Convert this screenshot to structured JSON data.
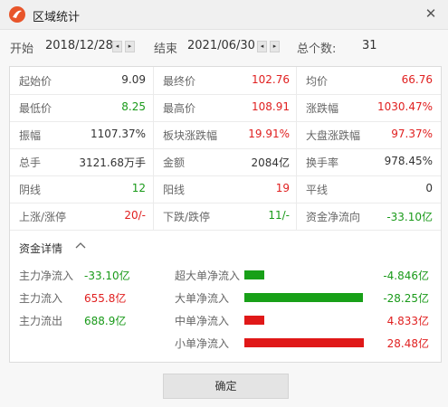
{
  "window": {
    "title": "区域统计",
    "close_glyph": "✕",
    "icons": [
      "app-logo-icon",
      "close-icon"
    ]
  },
  "range": {
    "start_label": "开始",
    "start_value": "2018/12/28",
    "end_label": "结束",
    "end_value": "2021/06/30",
    "count_label": "总个数:",
    "count_value": "31",
    "left_arrow": "◂",
    "right_arrow": "▸"
  },
  "colors": {
    "red": "#e02020",
    "green": "#1a9a1a",
    "bar_green": "#18a018",
    "bar_red": "#e01818"
  },
  "stats": {
    "row1": [
      {
        "label": "起始价",
        "value": "9.09",
        "color": "black"
      },
      {
        "label": "最终价",
        "value": "102.76",
        "color": "red"
      },
      {
        "label": "均价",
        "value": "66.76",
        "color": "red"
      }
    ],
    "row2": [
      {
        "label": "最低价",
        "value": "8.25",
        "color": "green"
      },
      {
        "label": "最高价",
        "value": "108.91",
        "color": "red"
      },
      {
        "label": "涨跌幅",
        "value": "1030.47%",
        "color": "red"
      }
    ],
    "row3": [
      {
        "label": "振幅",
        "value": "1107.37%",
        "color": "black"
      },
      {
        "label": "板块涨跌幅",
        "value": "19.91%",
        "color": "red"
      },
      {
        "label": "大盘涨跌幅",
        "value": "97.37%",
        "color": "red"
      }
    ],
    "row4": [
      {
        "label": "总手",
        "value": "3121.68万手",
        "color": "black"
      },
      {
        "label": "金额",
        "value": "2084亿",
        "color": "black"
      },
      {
        "label": "换手率",
        "value": "978.45%",
        "color": "black"
      }
    ],
    "row5": [
      {
        "label": "阴线",
        "value": "12",
        "color": "green"
      },
      {
        "label": "阳线",
        "value": "19",
        "color": "red"
      },
      {
        "label": "平线",
        "value": "0",
        "color": "black"
      }
    ],
    "row6": [
      {
        "label": "上涨/涨停",
        "value": "20/-",
        "color": "red"
      },
      {
        "label": "下跌/跌停",
        "value": "11/-",
        "color": "green"
      },
      {
        "label": "资金净流向",
        "value": "-33.10亿",
        "color": "green"
      }
    ]
  },
  "fund": {
    "title": "资金详情",
    "toggle_icon": "chevron-up-icon",
    "main_flow": [
      {
        "label": "主力净流入",
        "value": "-33.10亿",
        "color": "green"
      },
      {
        "label": "主力流入",
        "value": "655.8亿",
        "color": "red"
      },
      {
        "label": "主力流出",
        "value": "688.9亿",
        "color": "green"
      }
    ],
    "orders": [
      {
        "label": "超大单净流入",
        "value": "-4.846亿",
        "color": "green",
        "amount": -4.846
      },
      {
        "label": "大单净流入",
        "value": "-28.25亿",
        "color": "green",
        "amount": -28.25
      },
      {
        "label": "中单净流入",
        "value": "4.833亿",
        "color": "red",
        "amount": 4.833
      },
      {
        "label": "小单净流入",
        "value": "28.48亿",
        "color": "red",
        "amount": 28.48
      }
    ]
  },
  "footer": {
    "ok_label": "确定"
  }
}
